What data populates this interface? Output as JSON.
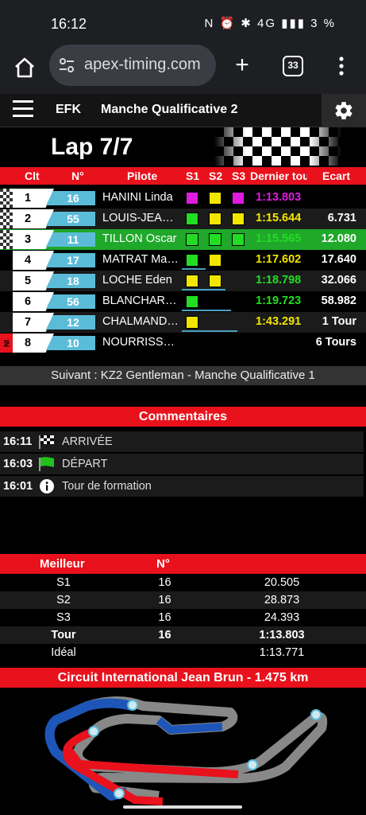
{
  "status": {
    "time": "16:12",
    "icons_text": "N ⏰ ✱ 4G ▮▮▮ 3 %"
  },
  "browser": {
    "url": "apex-timing.com",
    "tab_count": "33"
  },
  "header": {
    "club": "EFK",
    "session": "Manche Qualificative 2"
  },
  "lap": {
    "label": "Lap 7/7"
  },
  "columns": {
    "clt": "Clt",
    "num": "N°",
    "pilot": "Pilote",
    "s1": "S1",
    "s2": "S2",
    "s3": "S3",
    "last": "Dernier tou",
    "gap": "Ecart"
  },
  "rows": [
    {
      "pos": "1",
      "num": "16",
      "pilot": "HANINI Linda",
      "s": [
        "#e01be0",
        "#f2e600",
        "#e01be0"
      ],
      "last": "1:13.803",
      "last_color": "#e01be0",
      "gap": "",
      "mark": "chk",
      "bg": "",
      "progress": 0
    },
    {
      "pos": "2",
      "num": "55",
      "pilot": "LOUIS-JEAN Léo",
      "s": [
        "#22dd22",
        "#f2e600",
        "#f2e600"
      ],
      "last": "1:15.644",
      "last_color": "#f2e600",
      "gap": "6.731",
      "mark": "chk",
      "bg": "alt",
      "progress": 0
    },
    {
      "pos": "3",
      "num": "11",
      "pilot": "TILLON Oscar",
      "s": [
        "#22dd22",
        "#22dd22",
        "#22dd22"
      ],
      "last": "1:15.565",
      "last_color": "#22dd22",
      "gap": "12.080",
      "mark": "chk",
      "bg": "hl",
      "progress": 0
    },
    {
      "pos": "4",
      "num": "17",
      "pilot": "MATRAT Mattéo",
      "s": [
        "#22dd22",
        "#f2e600",
        ""
      ],
      "last": "1:17.602",
      "last_color": "#f2e600",
      "gap": "17.640",
      "mark": "",
      "bg": "",
      "progress": 0.3
    },
    {
      "pos": "5",
      "num": "18",
      "pilot": "LOCHE Eden",
      "s": [
        "#f2e600",
        "#f2e600",
        ""
      ],
      "last": "1:18.798",
      "last_color": "#22dd22",
      "gap": "32.066",
      "mark": "",
      "bg": "alt",
      "progress": 0.55
    },
    {
      "pos": "6",
      "num": "56",
      "pilot": "BLANCHARD Nathan",
      "s": [
        "#22dd22",
        "",
        ""
      ],
      "last": "1:19.723",
      "last_color": "#22dd22",
      "gap": "58.982",
      "mark": "",
      "bg": "",
      "progress": 0.62
    },
    {
      "pos": "7",
      "num": "12",
      "pilot": "CHALMANDIER Enzo",
      "s": [
        "#f2e600",
        "",
        ""
      ],
      "last": "1:43.291",
      "last_color": "#f2e600",
      "gap": "1 Tour",
      "mark": "",
      "bg": "alt",
      "progress": 0.7
    },
    {
      "pos": "8",
      "num": "10",
      "pilot": "NOURRISSON Lucas",
      "s": [
        "",
        "",
        ""
      ],
      "last": "",
      "last_color": "#fff",
      "gap": "6 Tours",
      "mark": "pit",
      "bg": "",
      "progress": 0
    }
  ],
  "pit_label": "IN",
  "next": "Suivant : KZ2 Gentleman - Manche Qualificative 1",
  "comments_title": "Commentaires",
  "comments": [
    {
      "time": "16:11",
      "icon": "checkered-flag-icon",
      "text": "ARRIVÉE"
    },
    {
      "time": "16:03",
      "icon": "green-flag-icon",
      "text": "DÉPART"
    },
    {
      "time": "16:01",
      "icon": "info-icon",
      "text": "Tour de formation"
    }
  ],
  "best": {
    "head": [
      "Meilleur",
      "N°",
      ""
    ],
    "rows": [
      {
        "label": "S1",
        "num": "16",
        "time": "20.505",
        "bold": false
      },
      {
        "label": "S2",
        "num": "16",
        "time": "28.873",
        "bold": false
      },
      {
        "label": "S3",
        "num": "16",
        "time": "24.393",
        "bold": false
      },
      {
        "label": "Tour",
        "num": "16",
        "time": "1:13.803",
        "bold": true
      },
      {
        "label": "Idéal",
        "num": "",
        "time": "1:13.771",
        "bold": false
      }
    ]
  },
  "circuit_title": "Circuit International Jean Brun - 1.475 km"
}
